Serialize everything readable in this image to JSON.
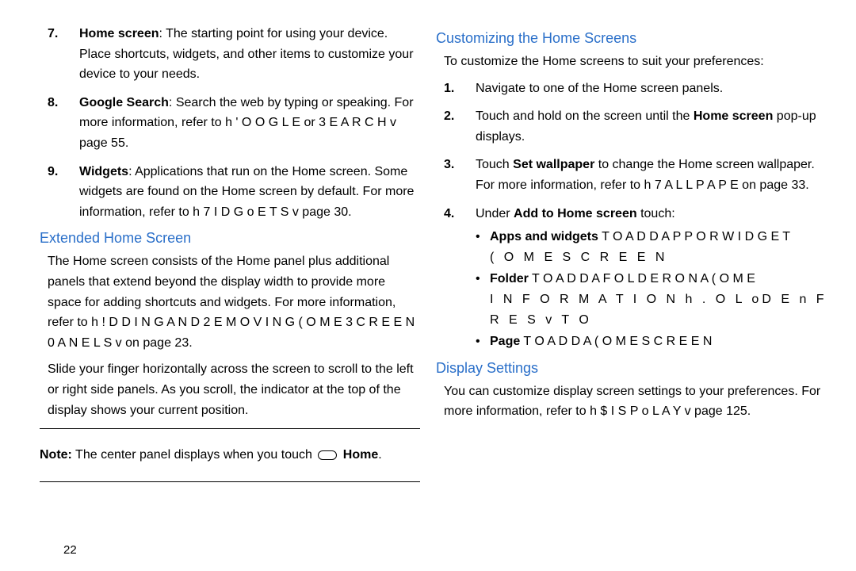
{
  "left": {
    "list": [
      {
        "n": "7.",
        "term": "Home screen",
        "text": ": The starting point for using your device. Place shortcuts, widgets, and other items to customize your device to your needs."
      },
      {
        "n": "8.",
        "term": "Google Search",
        "text": ": Search the web by typing or speaking. For more information, refer to ",
        "ref": "h ' O O G L E  or 3  E A R C H v",
        "tail": " page 55."
      },
      {
        "n": "9.",
        "term": "Widgets",
        "text": ": Applications that run on the Home screen. Some widgets are found on the Home screen by default. For more information, refer to ",
        "ref": "h 7 I D G o E  T S v",
        "tail": " page 30."
      }
    ],
    "heading": "Extended Home Screen",
    "p1a": "The Home screen consists of the Home panel plus additional panels that extend beyond the display width to provide more space for adding shortcuts and widgets. For more information, refer to ",
    "p1ref": "h ! D D I N G   A N D   2 E M O V I N G   ( O M E   3 C R E E N   0 A N E L S v",
    "p1b": " on page 23.",
    "p2": "Slide your finger horizontally across the screen to scroll to the left or right side panels. As you scroll, the indicator at the top of the display shows your current position.",
    "note_bold": "Note:",
    "note_text": " The center panel displays when you touch ",
    "note_home": "Home",
    "note_period": "."
  },
  "right": {
    "heading1": "Customizing the Home Screens",
    "intro": "To customize the Home screens to suit your preferences:",
    "steps": [
      {
        "n": "1.",
        "text": "Navigate to one of the Home screen panels."
      },
      {
        "n": "2.",
        "pre": "Touch and hold on the screen until the ",
        "bold": "Home screen",
        "post": " pop-up displays."
      },
      {
        "n": "3.",
        "pre": "Touch ",
        "bold": "Set wallpaper",
        "post": " to change the Home screen wallpaper. For more information, refer to ",
        "ref": "h 7 A L L P A P E",
        "tail": " on page 33."
      },
      {
        "n": "4.",
        "pre": "Under ",
        "bold": "Add to Home screen",
        "post": " touch:"
      }
    ],
    "bullets": [
      {
        "bold": "Apps and widgets",
        "spaced": "   T O   A D D   A P P   O R   W I D G E T",
        "line2": "( O M E   S C R E E N"
      },
      {
        "bold": "Folder",
        "spaced": "   T O   A D D   A   F O L D E R   O N   A   ( O M E",
        "line2": "I N F O R M A T I O N    h . O   L  oD E n F R E S v  T O"
      },
      {
        "bold": "Page",
        "spaced": "   T O   A D D   A   ( O M E   S C R E E N"
      }
    ],
    "heading2": "Display Settings",
    "p_disp_a": "You can customize display screen settings to your preferences. For more information, refer to ",
    "p_disp_ref": "h $ I S P o L  A Y v",
    "p_disp_b": " page 125."
  },
  "page_number": "22"
}
